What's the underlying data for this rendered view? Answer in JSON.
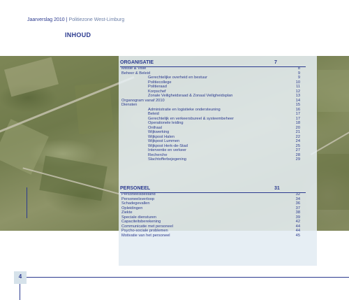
{
  "header": {
    "report": "Jaarverslag 2010",
    "separator": "|",
    "organisation": "Politiezone West-Limburg"
  },
  "title": "INHOUD",
  "page_number": "4",
  "sections": [
    {
      "label": "ORGANISATIE",
      "page": "7",
      "items": [
        {
          "text": "Missie & Visie",
          "page": "8",
          "level": 1
        },
        {
          "text": "Beheer & Beleid",
          "page": "9",
          "level": 1
        },
        {
          "text": "Gerechtelijke overheid en bestuur",
          "page": "9",
          "level": 2
        },
        {
          "text": "Politiecollege",
          "page": "10",
          "level": 2
        },
        {
          "text": "Politieraad",
          "page": "11",
          "level": 2
        },
        {
          "text": "Korpschef",
          "page": "12",
          "level": 2
        },
        {
          "text": "Zonale Veiligheidsraad & Zonaal Veiligheidsplan",
          "page": "13",
          "level": 2
        },
        {
          "text": "Organogram vanaf 2010",
          "page": "14",
          "level": 1
        },
        {
          "text": "Diensten",
          "page": "15",
          "level": 1
        },
        {
          "text": "Administratie en logistieke ondersteuning",
          "page": "16",
          "level": 2
        },
        {
          "text": "Beleid",
          "page": "17",
          "level": 2
        },
        {
          "text": "Gerechtelijk en verkeersbureel & systeembeheer",
          "page": "17",
          "level": 2
        },
        {
          "text": "Operationele leiding",
          "page": "18",
          "level": 2
        },
        {
          "text": "Onthaal",
          "page": "20",
          "level": 2
        },
        {
          "text": "Wijkwerking",
          "page": "21",
          "level": 2
        },
        {
          "text": "Wijkpost Halen",
          "page": "22",
          "level": 2
        },
        {
          "text": "Wijkpost Lummen",
          "page": "24",
          "level": 2
        },
        {
          "text": "Wijkpost Herk-de-Stad",
          "page": "25",
          "level": 2
        },
        {
          "text": "Interventie en verkeer",
          "page": "27",
          "level": 2
        },
        {
          "text": "Recherche",
          "page": "28",
          "level": 2
        },
        {
          "text": "Slachtofferbejegening",
          "page": "29",
          "level": 2
        }
      ]
    },
    {
      "label": "PERSONEEL",
      "page": "31",
      "items": [
        {
          "text": "Personeelsbestand",
          "page": "32",
          "level": 1
        },
        {
          "text": "Personeelsverloop",
          "page": "34",
          "level": 1
        },
        {
          "text": "Schadegevallen",
          "page": "36",
          "level": 1
        },
        {
          "text": "Opleidingen",
          "page": "37",
          "level": 1
        },
        {
          "text": "Ziekte",
          "page": "38",
          "level": 1
        },
        {
          "text": "Speciale diensturen",
          "page": "39",
          "level": 1
        },
        {
          "text": "Capaciteitsberekening",
          "page": "42",
          "level": 1
        },
        {
          "text": "Communicatie met personeel",
          "page": "44",
          "level": 1
        },
        {
          "text": "Psycho-sociale problemen",
          "page": "44",
          "level": 1
        },
        {
          "text": "Motivatie van het personeel",
          "page": "45",
          "level": 1
        }
      ]
    }
  ]
}
